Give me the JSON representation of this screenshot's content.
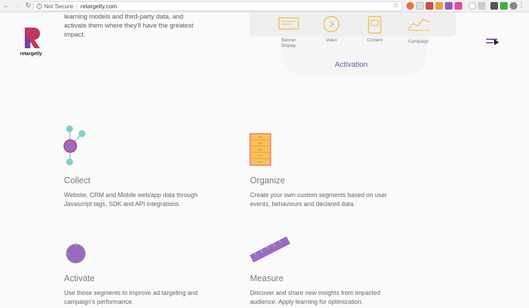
{
  "browser": {
    "security": "Not Secure",
    "url": "retargetly.com"
  },
  "brand": {
    "logo_text": "retargetly",
    "accent": "#7a54a0",
    "logo_colors": [
      "#c1385f",
      "#7a3ea8"
    ]
  },
  "intro": {
    "text": "learning models and third-party data, and activate them where they'll have the greatest impact."
  },
  "media_types": [
    {
      "label": "Banner Display",
      "icon": "banner-icon"
    },
    {
      "label": "Video",
      "icon": "video-play-icon"
    },
    {
      "label": "Content",
      "icon": "content-tablet-icon"
    },
    {
      "label": "Campaign",
      "icon": "campaign-chart-icon"
    }
  ],
  "activation_label": "Activation",
  "features": [
    {
      "title": "Collect",
      "text": "Website, CRM and Mobile web/app data through Javascript tags, SDK and API integrations.",
      "icon": "network-nodes-icon"
    },
    {
      "title": "Organize",
      "text": "Create your own custom segments based on user events, behaviours and declared data.",
      "icon": "file-cabinet-icon"
    },
    {
      "title": "Activate",
      "text": "Use those segments to improve ad targeting and campaign's performance.",
      "icon": "target-circle-icon"
    },
    {
      "title": "Measure",
      "text": "Discover and share new insights from impacted audience. Apply learning for optimization.",
      "icon": "ruler-icon"
    }
  ]
}
